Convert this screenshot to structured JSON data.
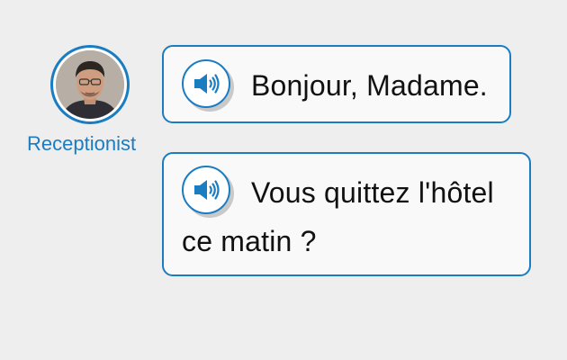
{
  "speaker": {
    "name": "Receptionist",
    "avatar_icon": "person-portrait-icon"
  },
  "dialogue": [
    {
      "text": "Bonjour, Madame.",
      "audio_icon": "speaker-icon"
    },
    {
      "text": "Vous quittez l'hôtel ce matin ?",
      "audio_icon": "speaker-icon"
    }
  ],
  "colors": {
    "accent": "#1a7cc1",
    "background": "#eeeeee",
    "bubble": "#f9f9f9"
  }
}
